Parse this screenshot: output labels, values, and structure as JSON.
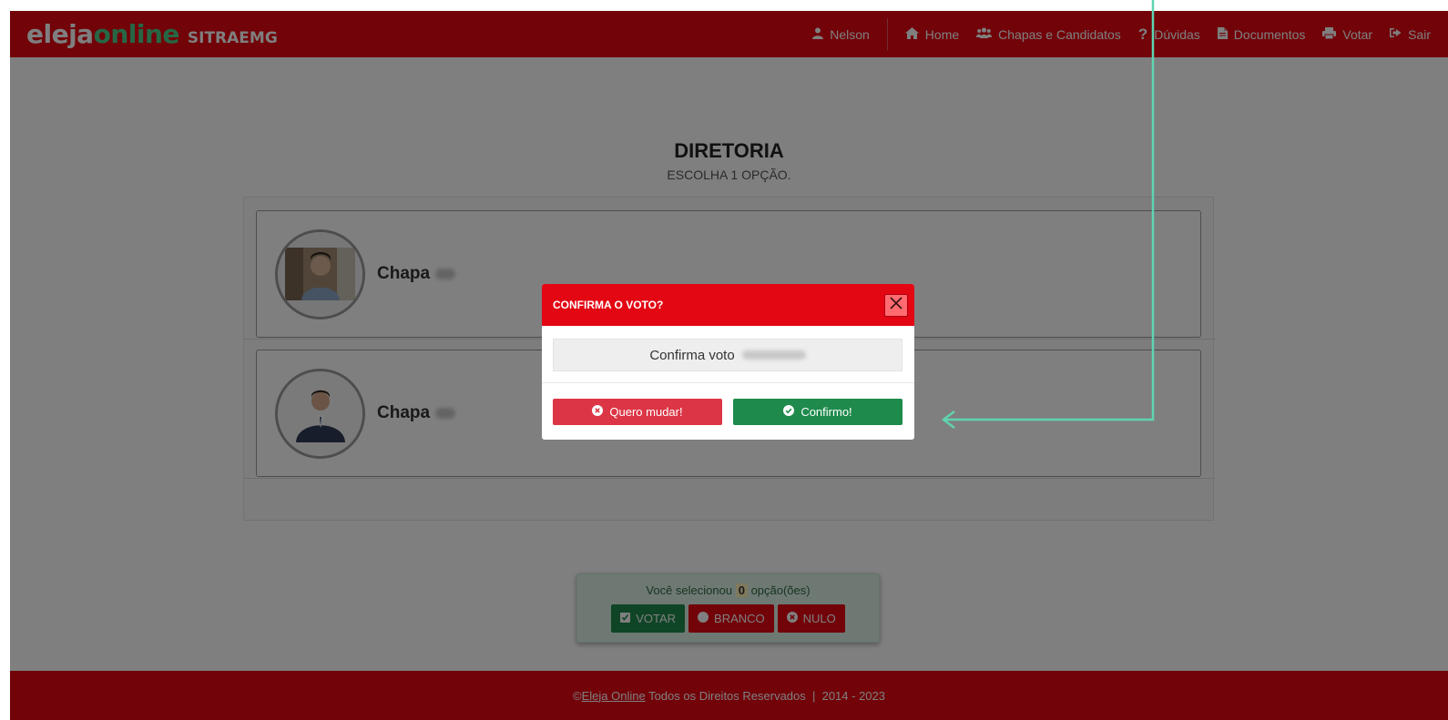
{
  "brand": {
    "logo_prefix": "eleja",
    "logo_suffix": "online",
    "org": "SITRAEMG"
  },
  "nav": {
    "user": "Nelson",
    "items": [
      {
        "label": "Home",
        "icon": "home-icon"
      },
      {
        "label": "Chapas e Candidatos",
        "icon": "users-icon"
      },
      {
        "label": "Dúvidas",
        "icon": "question-icon"
      },
      {
        "label": "Documentos",
        "icon": "document-icon"
      },
      {
        "label": "Votar",
        "icon": "print-icon"
      },
      {
        "label": "Sair",
        "icon": "sign-out-icon"
      }
    ]
  },
  "section": {
    "title": "DIRETORIA",
    "subtitle": "ESCOLHA 1 OPÇÃO."
  },
  "chapas": [
    {
      "label": "Chapa"
    },
    {
      "label": "Chapa"
    }
  ],
  "vote_box": {
    "text_before": "Você selecionou",
    "count": "0",
    "text_after": "opção(ões)",
    "buttons": {
      "votar": "VOTAR",
      "branco": "BRANCO",
      "nulo": "NULO"
    }
  },
  "footer": {
    "copyright": "©",
    "link": "Eleja Online",
    "rest": " Todos os Direitos Reservados  |  2014 - 2023"
  },
  "modal": {
    "title": "CONFIRMA O VOTO?",
    "body": "Confirma voto",
    "cancel": "Quero mudar!",
    "confirm": "Confirmo!"
  },
  "colors": {
    "brand_red": "#e30613",
    "success_green": "#1e8a4c",
    "annotation": "#5fd3b0"
  }
}
